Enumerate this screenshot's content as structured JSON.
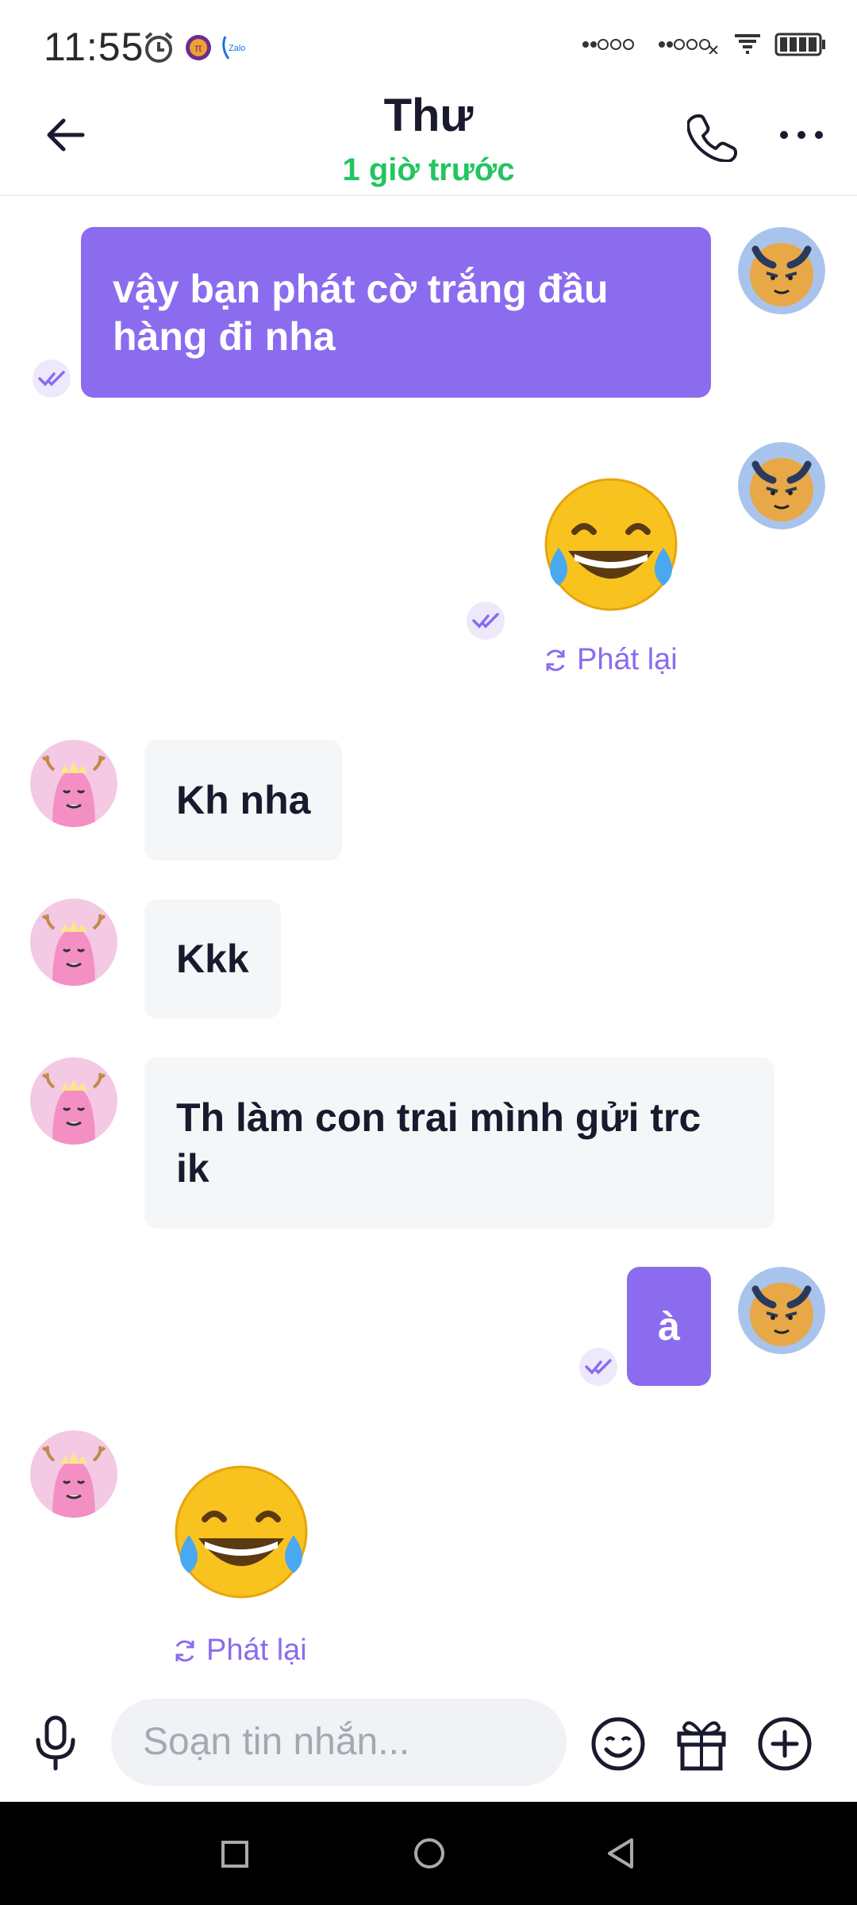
{
  "status_bar": {
    "time": "11:55"
  },
  "header": {
    "title": "Thư",
    "subtitle": "1 giờ trước"
  },
  "messages": [
    {
      "text": "vậy bạn phát cờ trắng đầu hàng đi nha"
    },
    {
      "replay_label": "Phát lại"
    },
    {
      "text": "Kh nha"
    },
    {
      "text": "Kkk"
    },
    {
      "text": "Th làm con trai mình gửi trc ik"
    },
    {
      "text": "à"
    },
    {
      "replay_label": "Phát lại"
    }
  ],
  "composer": {
    "placeholder": "Soạn tin nhắn..."
  },
  "colors": {
    "accent": "#8b6cef",
    "online": "#22c55e",
    "incoming_bg": "#f5f6f8"
  }
}
